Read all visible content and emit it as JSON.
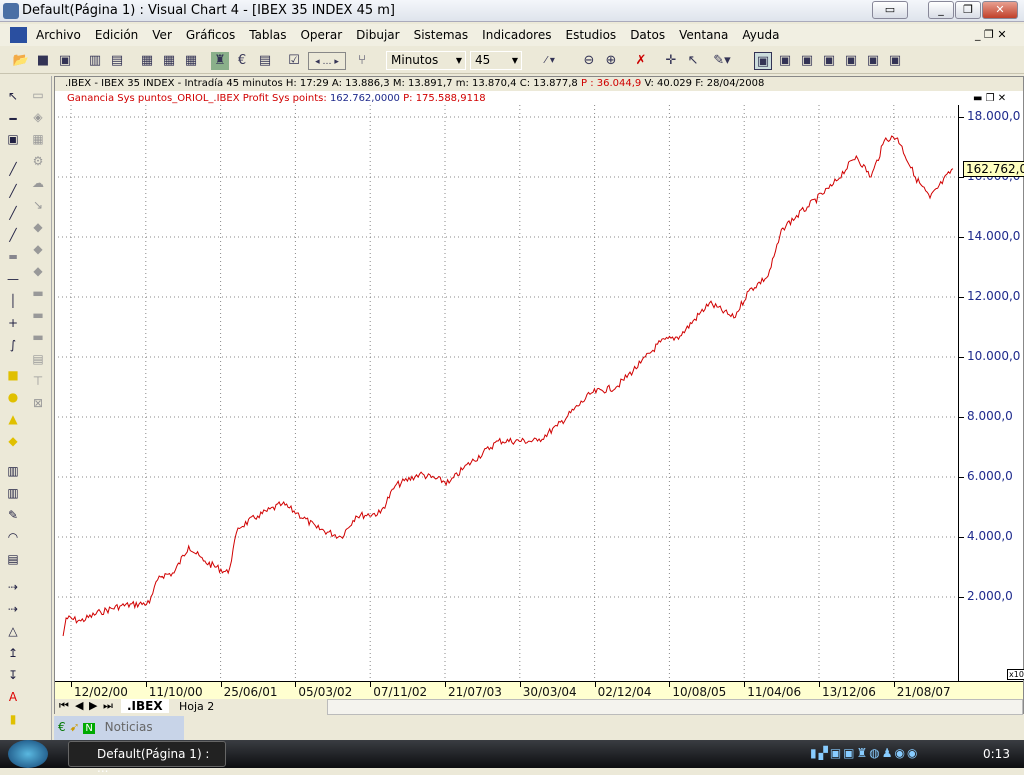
{
  "window": {
    "title": "Default(Página 1) : Visual Chart 4 - [IBEX 35 INDEX 45 m]"
  },
  "menu": [
    "Archivo",
    "Edición",
    "Ver",
    "Gráficos",
    "Tablas",
    "Operar",
    "Dibujar",
    "Sistemas",
    "Indicadores",
    "Estudios",
    "Datos",
    "Ventana",
    "Ayuda"
  ],
  "toolbar": {
    "period_unit": "Minutos",
    "period_value": "45"
  },
  "chart_header": {
    "symbol_line": ".IBEX - IBEX 35 INDEX - Intradía 45 minutos  H: 17:29  A: 13.886,3  M: 13.891,7  m: 13.870,4  C: 13.877,8",
    "p_label": "P : 36.044,9",
    "tail": "V: 40.029  F: 28/04/2008",
    "system_name": "Ganancia Sys puntos_ORIOL_.IBEX  Profit Sys points:",
    "system_value": "162.762,0000",
    "system_p": "P: 175.588,9118"
  },
  "colors": {
    "series": "#d00000",
    "axis_text": "#1e2a8c",
    "date_axis_bg": "#ffffd0"
  },
  "chart_data": {
    "type": "line",
    "xlabel": "",
    "ylabel": "",
    "ylim": [
      0,
      19000
    ],
    "y_ticks": [
      "2.000,0",
      "4.000,0",
      "6.000,0",
      "8.000,0",
      "10.000,0",
      "12.000,0",
      "14.000,0",
      "16.000,0",
      "18.000,0"
    ],
    "x_ticks": [
      "12/02/00",
      "11/10/00",
      "25/06/01",
      "05/03/02",
      "07/11/02",
      "21/07/03",
      "30/03/04",
      "02/12/04",
      "10/08/05",
      "11/04/06",
      "13/12/06",
      "21/08/07"
    ],
    "last_value_label": "162.762,0",
    "scale_note": "x10",
    "grid": true,
    "x": [
      "2000-01-23",
      "2000-02-02",
      "2000-03-23",
      "2000-05-29",
      "2000-08-03",
      "2000-11-11",
      "2000-12-14",
      "2001-02-02",
      "2001-03-24",
      "2001-05-13",
      "2001-08-05",
      "2001-09-07",
      "2001-11-13",
      "2002-02-04",
      "2002-03-26",
      "2002-06-01",
      "2002-08-23",
      "2002-10-12",
      "2003-01-03",
      "2003-02-22",
      "2003-05-16",
      "2003-08-24",
      "2003-10-13",
      "2004-02-07",
      "2004-06-19",
      "2004-08-25",
      "2004-12-19",
      "2005-03-13",
      "2005-06-04",
      "2005-08-10",
      "2005-10-15",
      "2006-01-23",
      "2006-04-16",
      "2006-06-05",
      "2006-08-10",
      "2006-09-29",
      "2006-12-21",
      "2007-03-14",
      "2007-06-05",
      "2007-07-25",
      "2007-09-13",
      "2007-10-23",
      "2007-12-22",
      "2008-02-10",
      "2008-04-28"
    ],
    "values": [
      700,
      1300,
      1200,
      1500,
      1700,
      1800,
      2700,
      2800,
      3700,
      3200,
      2800,
      4300,
      4700,
      5100,
      4800,
      4300,
      4000,
      4700,
      4800,
      5700,
      6100,
      5800,
      6300,
      7200,
      7200,
      7700,
      8800,
      9000,
      9800,
      10500,
      10700,
      11800,
      11300,
      12200,
      12700,
      14300,
      15000,
      15700,
      16700,
      16000,
      17300,
      17300,
      16000,
      15300,
      16276
    ]
  },
  "tabs": [
    ".IBEX",
    "Hoja 2"
  ],
  "bottom": {
    "news": "Noticias"
  },
  "taskbar": {
    "task": "Default(Página 1) : ...",
    "clock": "0:13"
  }
}
